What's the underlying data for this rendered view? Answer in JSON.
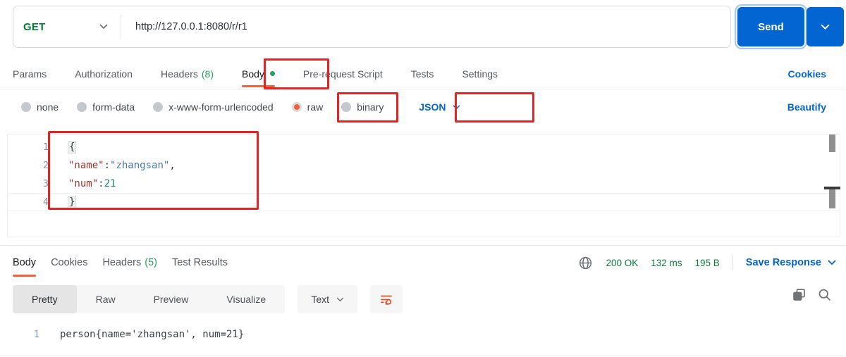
{
  "colors": {
    "accent_blue": "#0265D2",
    "method_green": "#007F31",
    "status_green": "#0E7E3C",
    "count_green": "#24A45C",
    "tab_indicator_orange": "#F0613C",
    "annotation_red": "#E12525",
    "wrap_icon_orange": "#DC5323",
    "code_key_maroon": "#A3342D",
    "code_string_blue": "#4A77A8",
    "code_number_teal": "#1A8271"
  },
  "icons": {
    "method_caret": "chevron-down",
    "send_caret": "chevron-down",
    "json_caret": "chevron-down",
    "save_response_caret": "chevron-down",
    "text_caret": "chevron-down",
    "network": "globe",
    "wrap": "text-wrap",
    "copy": "copy",
    "search": "magnifier"
  },
  "request": {
    "method": "GET",
    "url": "http://127.0.0.1:8080/r/r1",
    "send_label": "Send",
    "cookies_link": "Cookies",
    "tabs": [
      {
        "label": "Params"
      },
      {
        "label": "Authorization"
      },
      {
        "label": "Headers",
        "count": "(8)"
      },
      {
        "label": "Body"
      },
      {
        "label": "Pre-request Script"
      },
      {
        "label": "Tests"
      },
      {
        "label": "Settings"
      }
    ],
    "active_tab": "Body",
    "body_modes": [
      {
        "label": "none"
      },
      {
        "label": "form-data"
      },
      {
        "label": "x-www-form-urlencoded"
      },
      {
        "label": "raw"
      },
      {
        "label": "binary"
      }
    ],
    "selected_mode": "raw",
    "format_select": "JSON",
    "beautify_link": "Beautify",
    "editor": {
      "line_numbers": [
        "1",
        "2",
        "3",
        "4"
      ],
      "line1": {
        "brace": "{"
      },
      "line2": {
        "key": "\"name\"",
        "colon": ":",
        "value": "\"zhangsan\"",
        "comma": ","
      },
      "line3": {
        "key": "\"num\"",
        "colon": ":",
        "value": "21"
      },
      "line4": {
        "brace": "}"
      }
    }
  },
  "response": {
    "tabs": [
      {
        "label": "Body"
      },
      {
        "label": "Cookies"
      },
      {
        "label": "Headers",
        "count": "(5)"
      },
      {
        "label": "Test Results"
      }
    ],
    "active_tab": "Body",
    "status_code": "200 OK",
    "time": "132 ms",
    "size": "195 B",
    "save_response_label": "Save Response",
    "view_tabs": [
      {
        "label": "Pretty"
      },
      {
        "label": "Raw"
      },
      {
        "label": "Preview"
      },
      {
        "label": "Visualize"
      }
    ],
    "active_view": "Pretty",
    "language_select": "Text",
    "body_line_number": "1",
    "body_text": "person{name='zhangsan', num=21}"
  }
}
